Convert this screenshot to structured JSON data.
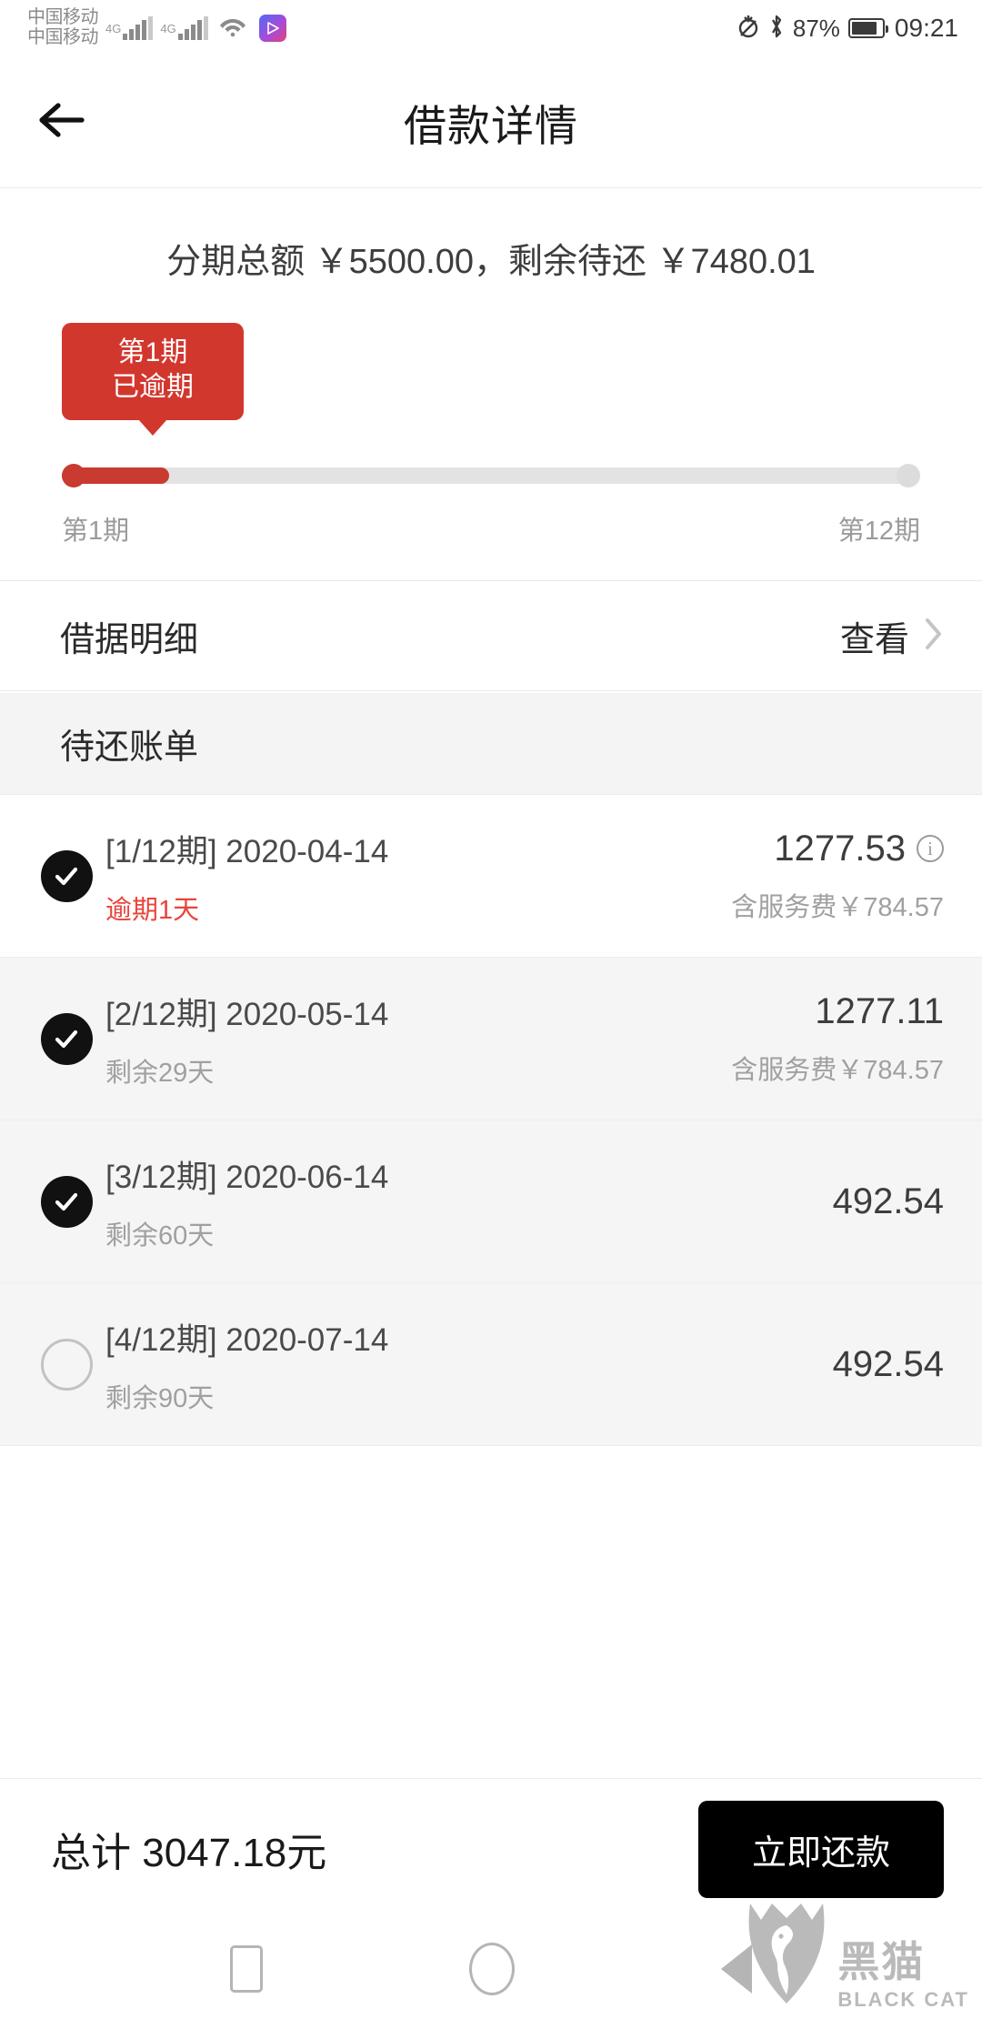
{
  "statusbar": {
    "carrier_line1": "中国移动",
    "carrier_line2": "中国移动",
    "net1": "4G",
    "net2": "4G",
    "battery_percent": "87%",
    "clock": "09:21"
  },
  "header": {
    "title": "借款详情",
    "back_icon": "arrow-left-icon"
  },
  "summary": {
    "text": "分期总额 ￥5500.00，剩余待还 ￥7480.01"
  },
  "progress": {
    "badge_line1": "第1期",
    "badge_line2": "已逾期",
    "badge_color": "#d2372e",
    "start_label": "第1期",
    "end_label": "第12期",
    "fill_percent": 12.5
  },
  "detail_row": {
    "label": "借据明细",
    "action": "查看",
    "chevron_icon": "chevron-right-icon"
  },
  "bills_section": {
    "title": "待还账单",
    "rows": [
      {
        "checked": true,
        "title": "[1/12期] 2020-04-14",
        "sub": "逾期1天",
        "sub_state": "overdue",
        "amount": "1277.53",
        "fee": "含服务费￥784.57",
        "has_info": true,
        "bg": "white"
      },
      {
        "checked": true,
        "title": "[2/12期] 2020-05-14",
        "sub": "剩余29天",
        "sub_state": "normal",
        "amount": "1277.11",
        "fee": "含服务费￥784.57",
        "has_info": false,
        "bg": "alt"
      },
      {
        "checked": true,
        "title": "[3/12期] 2020-06-14",
        "sub": "剩余60天",
        "sub_state": "normal",
        "amount": "492.54",
        "fee": "",
        "has_info": false,
        "bg": "alt"
      },
      {
        "checked": false,
        "title": "[4/12期] 2020-07-14",
        "sub": "剩余90天",
        "sub_state": "normal",
        "amount": "492.54",
        "fee": "",
        "has_info": false,
        "bg": "alt"
      }
    ]
  },
  "bottom_bar": {
    "total_text": "总计 3047.18元",
    "pay_label": "立即还款"
  },
  "navbar": {
    "recents_icon": "square-icon",
    "home_icon": "circle-icon",
    "back_icon": "triangle-back-icon"
  },
  "watermark": {
    "cn": "黑猫",
    "en": "BLACK CAT"
  }
}
